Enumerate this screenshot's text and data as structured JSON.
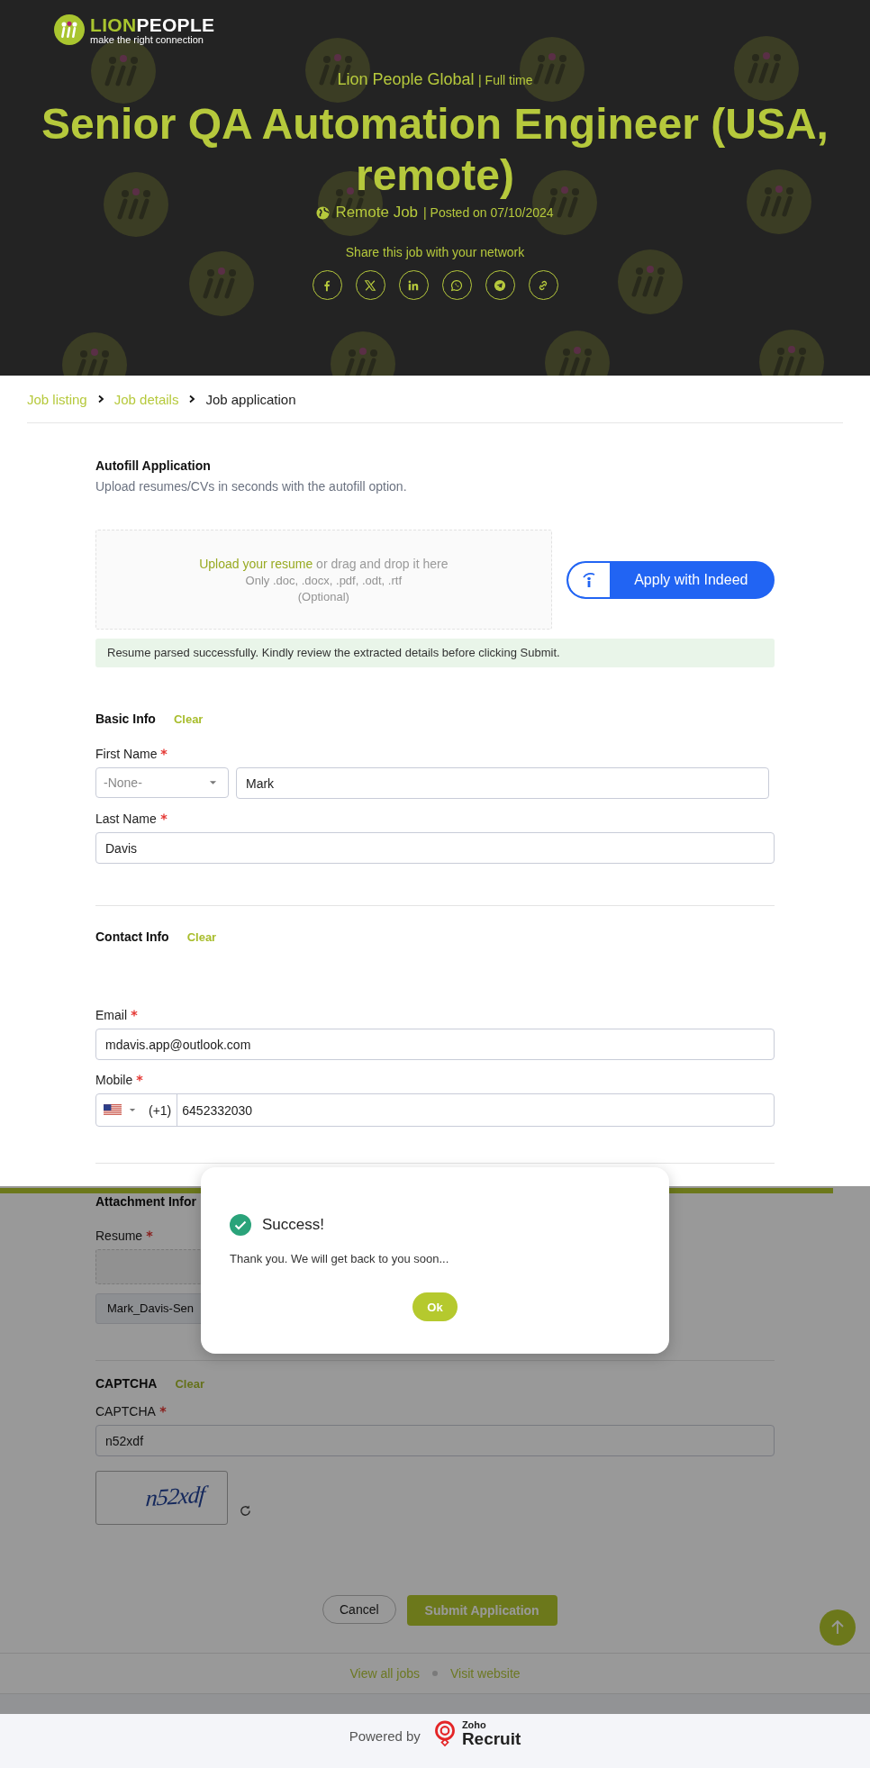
{
  "header": {
    "logo": {
      "brand_first": "LION",
      "brand_second": "PEOPLE",
      "tagline": "make the right connection"
    },
    "company": "Lion People Global",
    "employment_type": "| Full time",
    "title": "Senior QA Automation Engineer (USA, remote)",
    "location": "Remote Job",
    "posted": "| Posted on 07/10/2024",
    "share_label": "Share this job with your network",
    "share_buttons": [
      {
        "kind": "facebook"
      },
      {
        "kind": "x"
      },
      {
        "kind": "linkedin"
      },
      {
        "kind": "whatsapp"
      },
      {
        "kind": "telegram"
      },
      {
        "kind": "link"
      }
    ]
  },
  "breadcrumb": [
    {
      "label": "Job listing",
      "current": false
    },
    {
      "label": "Job details",
      "current": false
    },
    {
      "label": "Job application",
      "current": true
    }
  ],
  "autofill": {
    "heading": "Autofill Application",
    "subtitle": "Upload resumes/CVs in seconds with the autofill option.",
    "upload_link": "Upload your resume",
    "upload_text": "or drag and drop it here",
    "formats": "Only .doc, .docx, .pdf, .odt, .rtf",
    "optional": "(Optional)",
    "indeed_button": "Apply with Indeed",
    "parse_message": "Resume parsed successfully. Kindly review the extracted details before clicking Submit."
  },
  "basic_info": {
    "title": "Basic Info",
    "clear": "Clear",
    "first_name": {
      "label": "First Name",
      "required": true,
      "salutation": "-None-",
      "value": "Mark"
    },
    "last_name": {
      "label": "Last Name",
      "required": true,
      "value": "Davis"
    }
  },
  "contact_info": {
    "title": "Contact Info",
    "clear": "Clear",
    "email": {
      "label": "Email",
      "required": true,
      "value": "mdavis.app@outlook.com"
    },
    "mobile": {
      "label": "Mobile",
      "required": true,
      "country_code": "(+1)",
      "value": "6452332030"
    }
  },
  "attachment_info": {
    "title": "Attachment Infor",
    "resume": {
      "label": "Resume",
      "required": true,
      "file_name": "Mark_Davis-Sen"
    }
  },
  "captcha": {
    "title": "CAPTCHA",
    "clear": "Clear",
    "label": "CAPTCHA",
    "required": true,
    "value": "n52xdf",
    "image_text": "n52xdf"
  },
  "buttons": {
    "cancel": "Cancel",
    "submit": "Submit Application"
  },
  "footer_links": [
    "View all jobs",
    "Visit website"
  ],
  "powered_by": {
    "label": "Powered by",
    "brand_small": "Zoho",
    "brand_large": "Recruit"
  },
  "dialog": {
    "title": "Success!",
    "message": "Thank you. We will get back to you soon...",
    "button": "Ok"
  }
}
